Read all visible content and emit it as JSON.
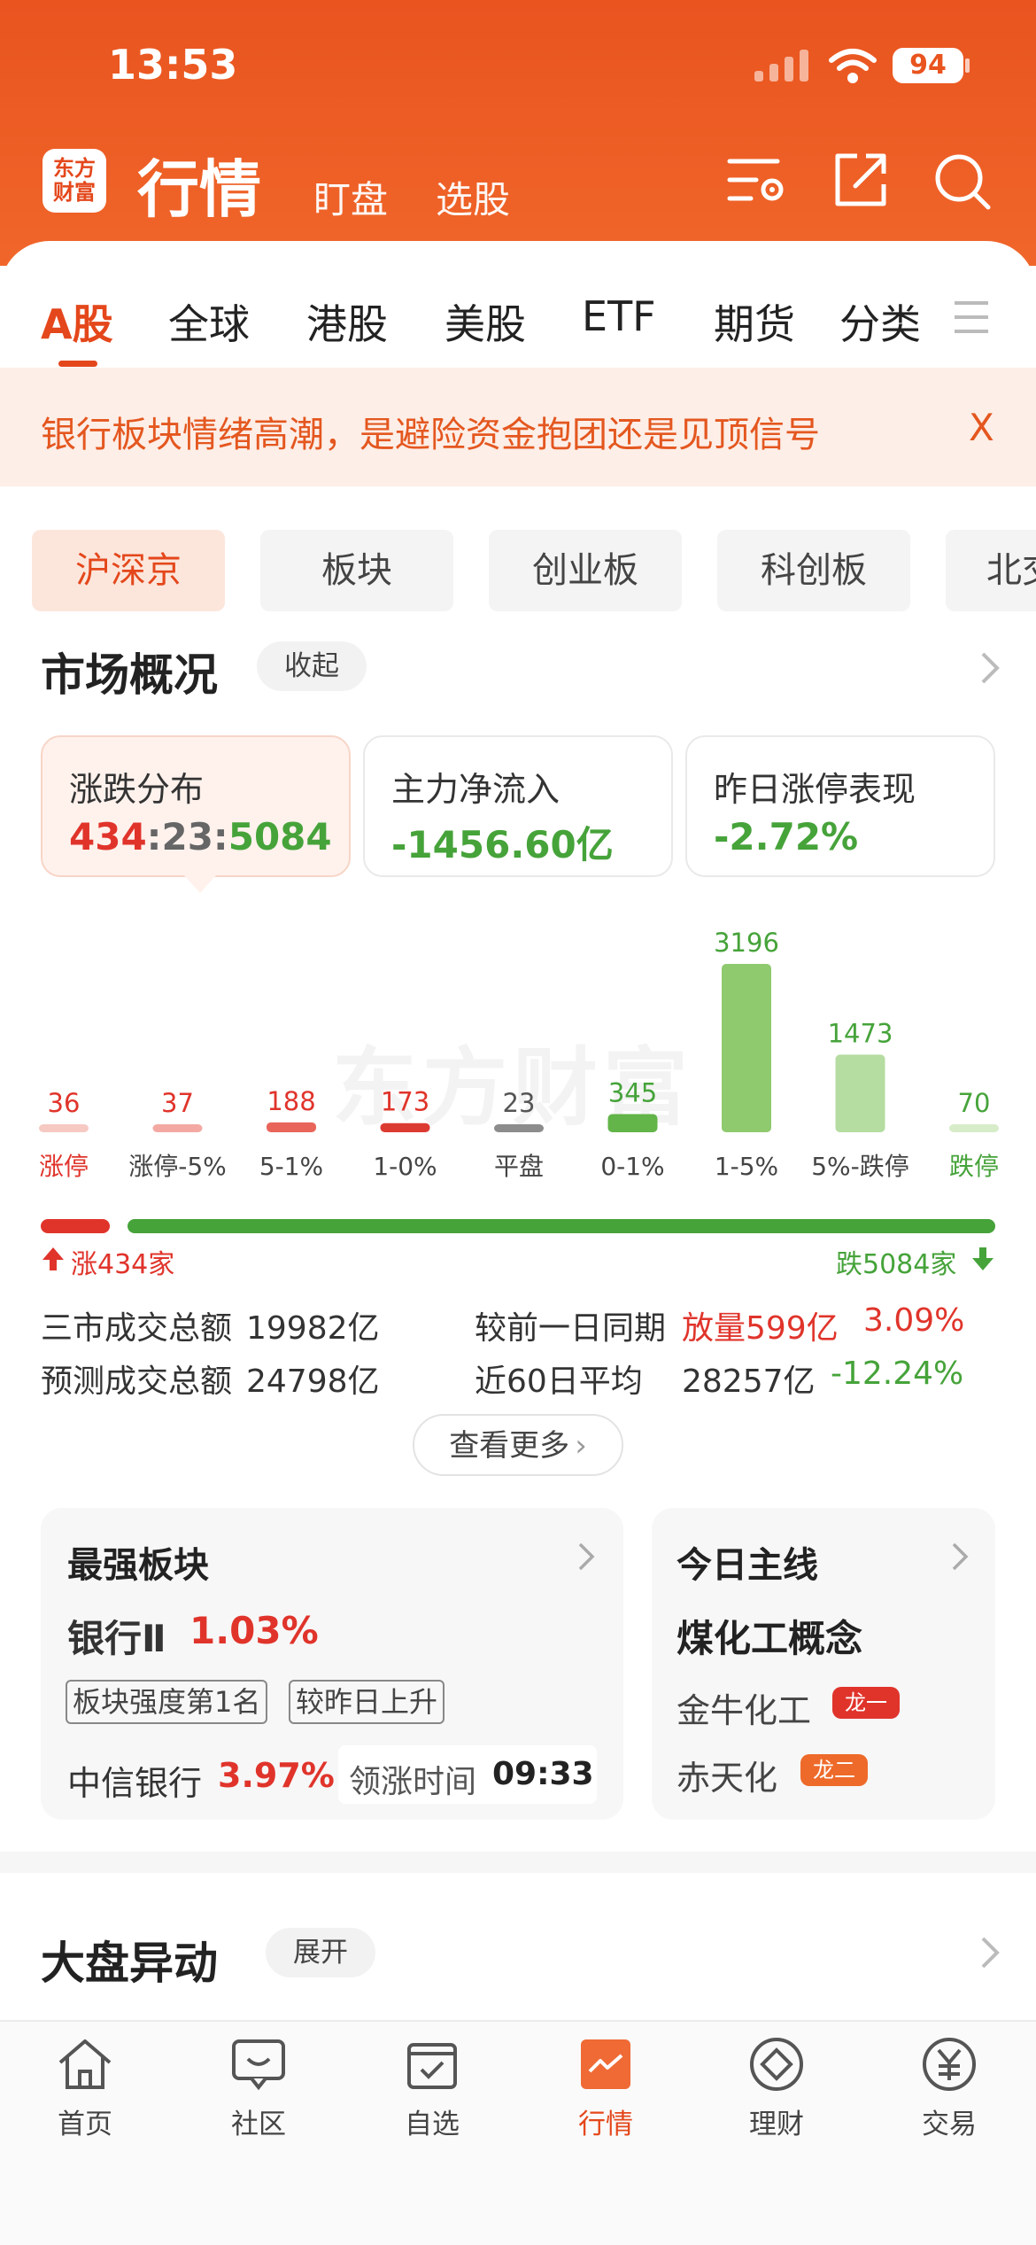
{
  "status": {
    "time": "13:53",
    "battery": "94"
  },
  "header": {
    "logo_line1": "东方",
    "logo_line2": "财富",
    "title": "行情",
    "tabs": [
      {
        "label": "盯盘"
      },
      {
        "label": "选股"
      }
    ],
    "icons": [
      "filter-settings-icon",
      "share-icon",
      "search-icon"
    ]
  },
  "market_tabs": [
    {
      "label": "A股"
    },
    {
      "label": "全球"
    },
    {
      "label": "港股"
    },
    {
      "label": "美股"
    },
    {
      "label": "ETF"
    },
    {
      "label": "期货"
    },
    {
      "label": "分类"
    }
  ],
  "banner": {
    "text": "银行板块情绪高潮，是避险资金抱团还是见顶信号",
    "close": "X"
  },
  "sub_tabs": [
    {
      "label": "沪深京"
    },
    {
      "label": "板块"
    },
    {
      "label": "创业板"
    },
    {
      "label": "科创板"
    },
    {
      "label": "北交"
    }
  ],
  "overview": {
    "title": "市场概况",
    "collapse_label": "收起",
    "cards": [
      {
        "label": "涨跌分布",
        "up": "434",
        "sep1": ":",
        "flat": "23",
        "sep2": ":",
        "down": "5084"
      },
      {
        "label": "主力净流入",
        "value": "-1456.60亿"
      },
      {
        "label": "昨日涨停表现",
        "value": "-2.72%"
      }
    ],
    "watermark": "东方财富"
  },
  "chart_data": {
    "type": "bar",
    "categories": [
      "涨停",
      "涨停-5%",
      "5-1%",
      "1-0%",
      "平盘",
      "0-1%",
      "1-5%",
      "5%-跌停",
      "跌停"
    ],
    "values": [
      36,
      37,
      188,
      173,
      23,
      345,
      3196,
      1473,
      70
    ],
    "colors": [
      "#f6c9c3",
      "#f3a9a2",
      "#e9655a",
      "#dc3b32",
      "#8c8c8c",
      "#63b449",
      "#8fca6f",
      "#b5dca1",
      "#d7ecc9"
    ],
    "label_colors": [
      "#e0342b",
      "#e0342b",
      "#e0342b",
      "#e0342b",
      "#555555",
      "#46a33a",
      "#46a33a",
      "#46a33a",
      "#46a33a"
    ],
    "category_colors": [
      "#e0342b",
      "#444444",
      "#444444",
      "#444444",
      "#444444",
      "#444444",
      "#444444",
      "#444444",
      "#46a33a"
    ],
    "ylim": [
      0,
      3196
    ]
  },
  "ratio": {
    "up_label": "涨434家",
    "down_label": "跌5084家",
    "up": 434,
    "flat": 23,
    "down": 5084,
    "up_color": "#e0342b",
    "down_color": "#46a33a"
  },
  "stats": {
    "turnover_label": "三市成交总额",
    "turnover_value": "19982亿",
    "forecast_label": "预测成交总额",
    "forecast_value": "24798亿",
    "prev_label": "较前一日同期",
    "prev_value": "放量599亿",
    "prev_pct": "3.09%",
    "avg60_label": "近60日平均",
    "avg60_value": "28257亿",
    "avg60_pct": "-12.24%",
    "more_label": "查看更多"
  },
  "strongest": {
    "title": "最强板块",
    "sector": "银行Ⅱ",
    "sector_pct": "1.03%",
    "tags": [
      "板块强度第1名",
      "较昨日上升"
    ],
    "leader": "中信银行",
    "leader_pct": "3.97%",
    "lead_time_label": "领涨时间",
    "lead_time": "09:33"
  },
  "mainline": {
    "title": "今日主线",
    "concept": "煤化工概念",
    "stocks": [
      {
        "name": "金牛化工",
        "tag": "龙一",
        "tag_color": "#e0342b"
      },
      {
        "name": "赤天化",
        "tag": "龙二",
        "tag_color": "#ee6a2a"
      }
    ]
  },
  "movement": {
    "title": "大盘异动",
    "expand_label": "展开"
  },
  "nav": [
    {
      "label": "首页",
      "icon": "home-icon"
    },
    {
      "label": "社区",
      "icon": "community-icon"
    },
    {
      "label": "自选",
      "icon": "watchlist-icon"
    },
    {
      "label": "行情",
      "icon": "market-icon"
    },
    {
      "label": "理财",
      "icon": "wealth-icon"
    },
    {
      "label": "交易",
      "icon": "trade-icon"
    }
  ]
}
